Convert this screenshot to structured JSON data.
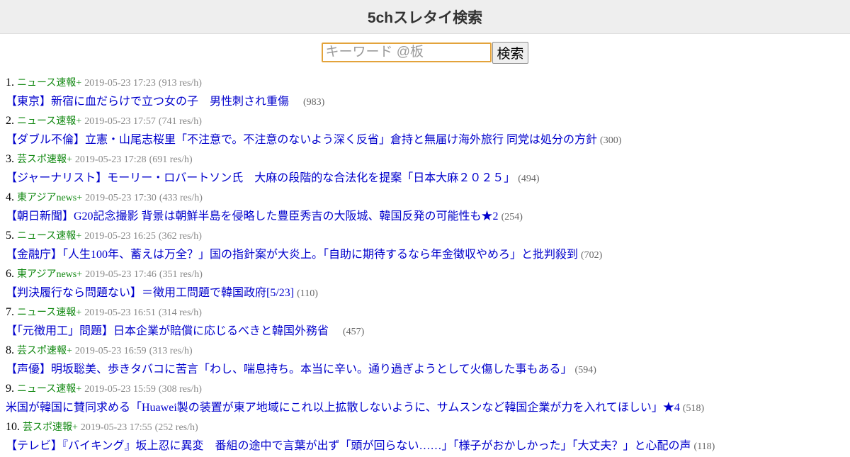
{
  "header": {
    "title": "5chスレタイ検索"
  },
  "search": {
    "placeholder": "キーワード @板",
    "button_label": "検索"
  },
  "results": [
    {
      "rank": "1.",
      "board": "ニュース速報+",
      "timestamp": "2019-05-23 17:23",
      "rate": "(913 res/h)",
      "title": "【東京】新宿に血だらけで立つ女の子　男性刺され重傷　",
      "count": "(983)"
    },
    {
      "rank": "2.",
      "board": "ニュース速報+",
      "timestamp": "2019-05-23 17:57",
      "rate": "(741 res/h)",
      "title": "【ダブル不倫】立憲・山尾志桜里「不注意で。不注意のないよう深く反省」倉持と無届け海外旅行 同党は処分の方針",
      "count": "(300)"
    },
    {
      "rank": "3.",
      "board": "芸スポ速報+",
      "timestamp": "2019-05-23 17:28",
      "rate": "(691 res/h)",
      "title": "【ジャーナリスト】モーリー・ロバートソン氏　大麻の段階的な合法化を提案「日本大麻２０２５」",
      "count": "(494)"
    },
    {
      "rank": "4.",
      "board": "東アジアnews+",
      "timestamp": "2019-05-23 17:30",
      "rate": "(433 res/h)",
      "title": "【朝日新聞】G20記念撮影 背景は朝鮮半島を侵略した豊臣秀吉の大阪城、韓国反発の可能性も★2",
      "count": "(254)"
    },
    {
      "rank": "5.",
      "board": "ニュース速報+",
      "timestamp": "2019-05-23 16:25",
      "rate": "(362 res/h)",
      "title": "【金融庁】「人生100年、蓄えは万全？」国の指針案が大炎上。「自助に期待するなら年金徴収やめろ」と批判殺到",
      "count": "(702)"
    },
    {
      "rank": "6.",
      "board": "東アジアnews+",
      "timestamp": "2019-05-23 17:46",
      "rate": "(351 res/h)",
      "title": "【判決履行なら問題ない】＝徴用工問題で韓国政府[5/23]",
      "count": "(110)"
    },
    {
      "rank": "7.",
      "board": "ニュース速報+",
      "timestamp": "2019-05-23 16:51",
      "rate": "(314 res/h)",
      "title": "【「元徴用工」問題】日本企業が賠償に応じるべきと韓国外務省　",
      "count": "(457)"
    },
    {
      "rank": "8.",
      "board": "芸スポ速報+",
      "timestamp": "2019-05-23 16:59",
      "rate": "(313 res/h)",
      "title": "【声優】明坂聡美、歩きタバコに苦言「わし、喘息持ち。本当に辛い。通り過ぎようとして火傷した事もある」",
      "count": "(594)"
    },
    {
      "rank": "9.",
      "board": "ニュース速報+",
      "timestamp": "2019-05-23 15:59",
      "rate": "(308 res/h)",
      "title": "米国が韓国に賛同求める「Huawei製の装置が東ア地域にこれ以上拡散しないように、サムスンなど韓国企業が力を入れてほしい」★4",
      "count": "(518)"
    },
    {
      "rank": "10.",
      "board": "芸スポ速報+",
      "timestamp": "2019-05-23 17:55",
      "rate": "(252 res/h)",
      "title": "【テレビ】『バイキング』坂上忍に異変　番組の途中で言葉が出ず「頭が回らない……」「様子がおかしかった」「大丈夫？」と心配の声",
      "count": "(118)"
    }
  ]
}
